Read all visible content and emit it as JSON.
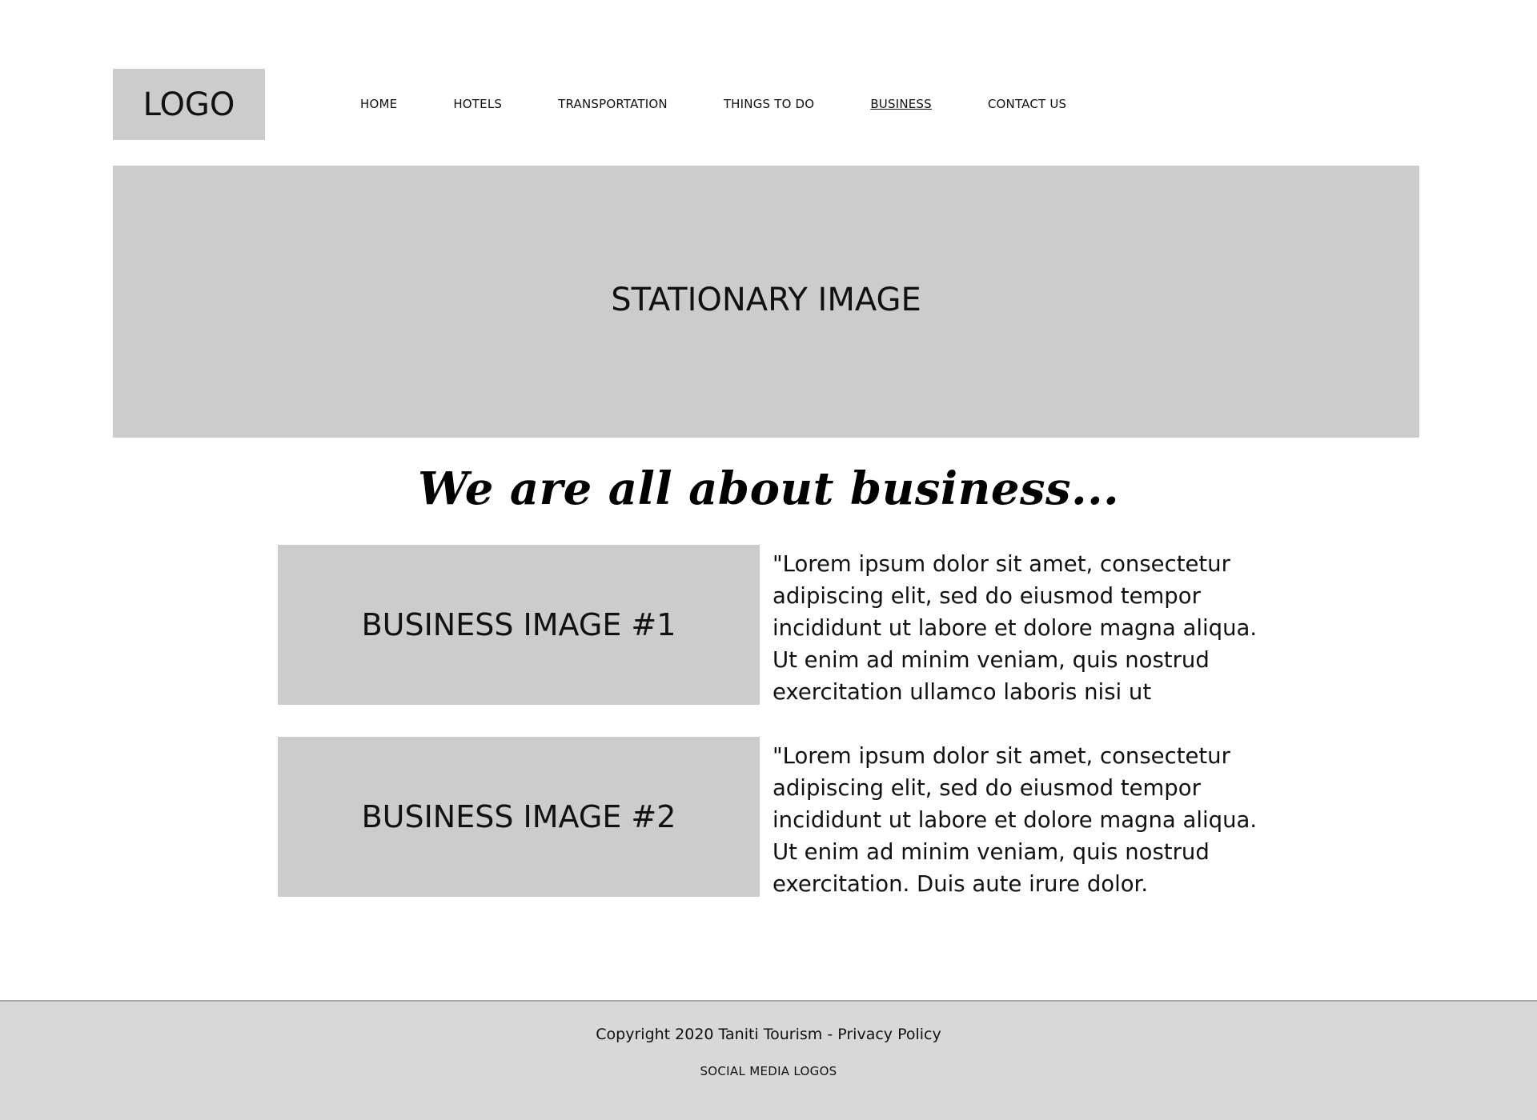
{
  "header": {
    "logo": "LOGO",
    "nav": [
      {
        "label": "HOME"
      },
      {
        "label": "HOTELS"
      },
      {
        "label": "TRANSPORTATION"
      },
      {
        "label": "THINGS TO DO"
      },
      {
        "label": "BUSINESS",
        "active": true
      },
      {
        "label": "CONTACT US"
      }
    ]
  },
  "hero": {
    "label": "STATIONARY IMAGE"
  },
  "main": {
    "tagline": "We are all about business...",
    "items": [
      {
        "image_label": "BUSINESS IMAGE #1",
        "text": "\"Lorem ipsum dolor sit amet, consectetur adipiscing elit, sed do eiusmod tempor incididunt ut labore et dolore magna aliqua. Ut enim ad minim veniam, quis nostrud exercitation ullamco laboris nisi ut"
      },
      {
        "image_label": "BUSINESS IMAGE #2",
        "text": "\"Lorem ipsum dolor sit amet, consectetur adipiscing elit, sed do eiusmod tempor incididunt ut labore et dolore magna aliqua. Ut enim ad minim veniam, quis nostrud exercitation. Duis aute irure dolor."
      }
    ]
  },
  "footer": {
    "copyright": "Copyright 2020 Taniti Tourism",
    "separator": " - ",
    "privacy_label": "Privacy Policy",
    "social": "SOCIAL MEDIA LOGOS"
  },
  "colors": {
    "placeholder_gray": "#cccccc",
    "footer_bg": "#d8d8d8",
    "text": "#111111"
  }
}
